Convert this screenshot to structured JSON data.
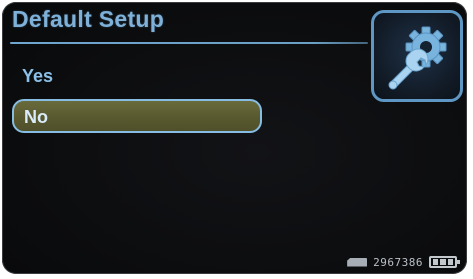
{
  "title": "Default Setup",
  "menu": {
    "items": [
      {
        "label": "Yes",
        "selected": false
      },
      {
        "label": "No",
        "selected": true
      }
    ]
  },
  "header_icon": "wrench-gear-icon",
  "status": {
    "card_icon": "memory-card-icon",
    "free_space": "2967386",
    "battery_icon": "battery-icon",
    "battery_level": 1.0
  },
  "colors": {
    "accent": "#7fb1d8",
    "selection_fill": "#5c5d31",
    "selection_border": "#87bde2",
    "background": "#0e0f11"
  }
}
